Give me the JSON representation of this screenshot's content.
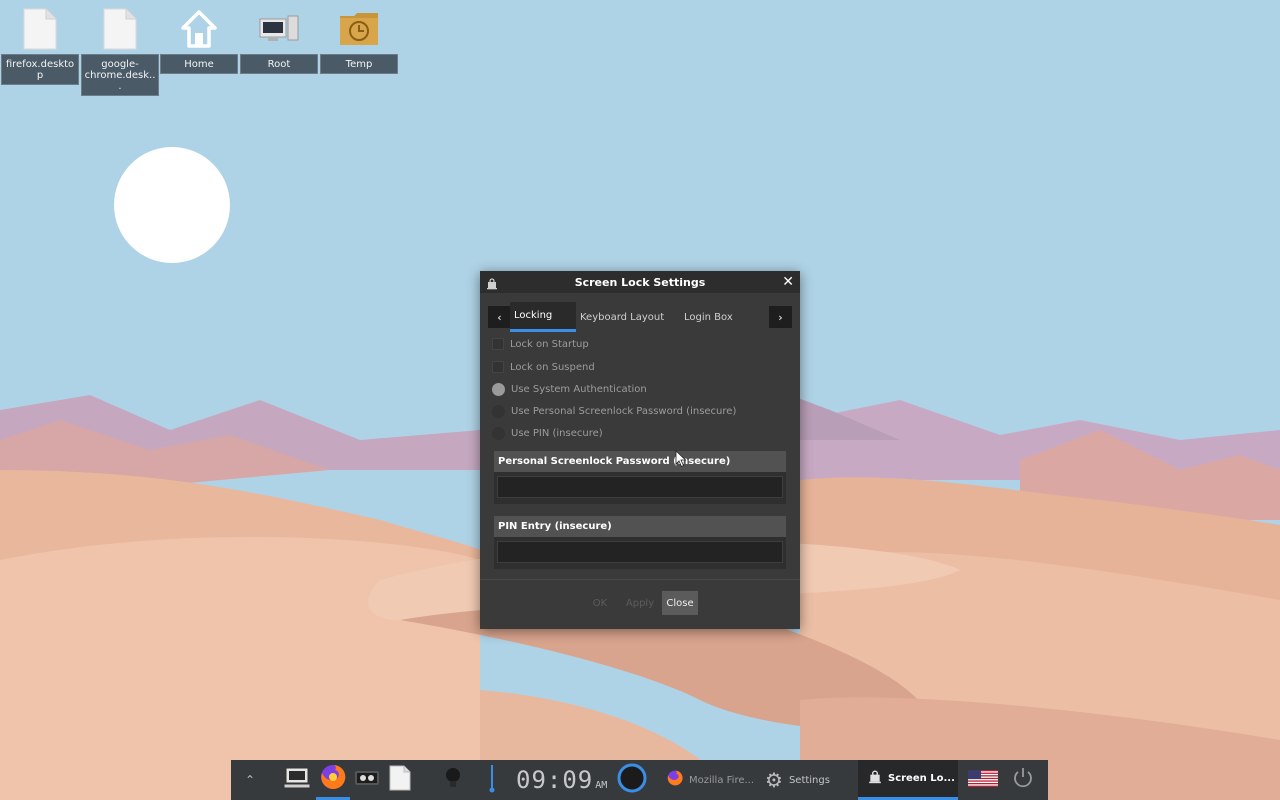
{
  "desktop": {
    "icons": [
      {
        "label": "firefox.desktop"
      },
      {
        "label": "google-chrome.desk..."
      },
      {
        "label": "Home"
      },
      {
        "label": "Root"
      },
      {
        "label": "Temp"
      }
    ]
  },
  "dialog": {
    "title": "Screen Lock Settings",
    "tabs": [
      {
        "label": "Locking",
        "active": true
      },
      {
        "label": "Keyboard Layout",
        "active": false
      },
      {
        "label": "Login Box",
        "active": false
      }
    ],
    "options": [
      {
        "label": "Lock on Startup",
        "type": "checkbox",
        "checked": false
      },
      {
        "label": "Lock on Suspend",
        "type": "checkbox",
        "checked": false
      },
      {
        "label": "Use System Authentication",
        "type": "radio",
        "checked": true
      },
      {
        "label": "Use Personal Screenlock Password (insecure)",
        "type": "radio",
        "checked": false
      },
      {
        "label": "Use PIN (insecure)",
        "type": "radio",
        "checked": false
      }
    ],
    "groups": [
      {
        "title": "Personal Screenlock Password (insecure)",
        "value": ""
      },
      {
        "title": "PIN Entry (insecure)",
        "value": ""
      }
    ],
    "buttons": {
      "ok": "OK",
      "apply": "Apply",
      "close": "Close"
    }
  },
  "taskbar": {
    "clock": {
      "time": "09:09",
      "ampm": "AM"
    },
    "tasks": [
      {
        "label": "Mozilla Fire..."
      },
      {
        "label": "Settings"
      },
      {
        "label": "Screen Lo..."
      }
    ]
  },
  "icons": [
    "chevron-up-icon",
    "computer-icon",
    "firefox-icon",
    "terminal-icon",
    "file-icon",
    "bulb-icon",
    "volume-icon",
    "circle-icon",
    "gear-icon",
    "lock-icon",
    "us-flag-icon",
    "power-icon"
  ],
  "colors": {
    "accent": "#3a8ee6",
    "dialog_bg": "#3a3a3a",
    "taskbar_bg": "#373a3d"
  }
}
